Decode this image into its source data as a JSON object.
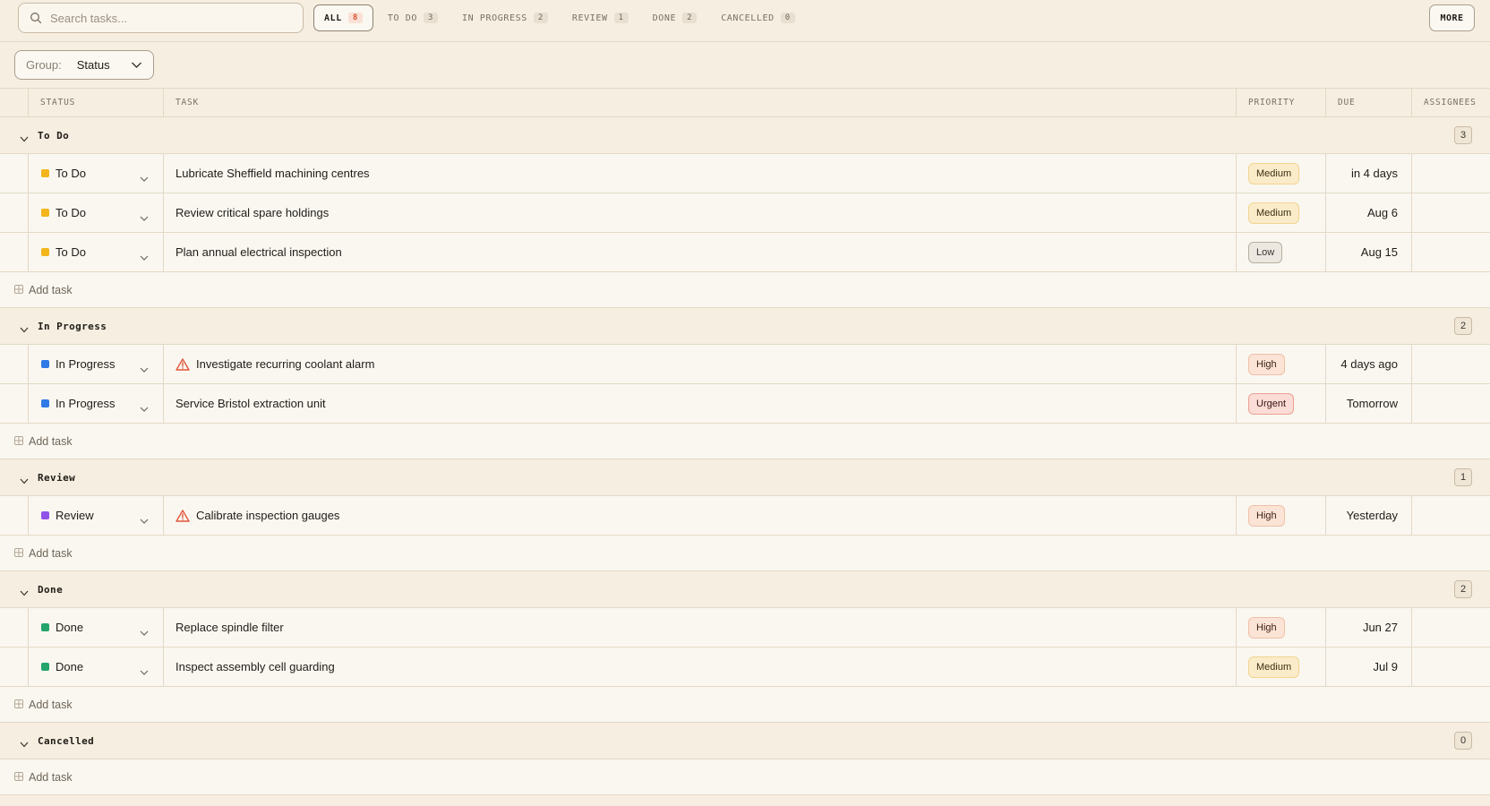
{
  "search": {
    "placeholder": "Search tasks..."
  },
  "tabs": [
    {
      "label": "ALL",
      "count": "8",
      "active": true
    },
    {
      "label": "TO DO",
      "count": "3"
    },
    {
      "label": "IN PROGRESS",
      "count": "2"
    },
    {
      "label": "REVIEW",
      "count": "1"
    },
    {
      "label": "DONE",
      "count": "2"
    },
    {
      "label": "CANCELLED",
      "count": "0"
    }
  ],
  "more_label": "MORE",
  "group": {
    "label": "Group:",
    "value": "Status"
  },
  "columns": {
    "status": "STATUS",
    "task": "TASK",
    "priority": "PRIORITY",
    "due": "DUE",
    "assignees": "ASSIGNEES"
  },
  "add_task_label": "Add task",
  "colors": {
    "todo": "#f2b61b",
    "in_progress": "#2f7ae5",
    "review": "#9152e8",
    "done": "#24a46b"
  },
  "groups": [
    {
      "title": "To Do",
      "count": "3",
      "rows": [
        {
          "status": "To Do",
          "task": "Lubricate Sheffield machining centres",
          "priority": "Medium",
          "due": "in 4 days"
        },
        {
          "status": "To Do",
          "task": "Review critical spare holdings",
          "priority": "Medium",
          "due": "Aug 6"
        },
        {
          "status": "To Do",
          "task": "Plan annual electrical inspection",
          "priority": "Low",
          "due": "Aug 15"
        }
      ]
    },
    {
      "title": "In Progress",
      "count": "2",
      "rows": [
        {
          "status": "In Progress",
          "task": "Investigate recurring coolant alarm",
          "priority": "High",
          "due": "4 days ago",
          "warning": true
        },
        {
          "status": "In Progress",
          "task": "Service Bristol extraction unit",
          "priority": "Urgent",
          "due": "Tomorrow"
        }
      ]
    },
    {
      "title": "Review",
      "count": "1",
      "rows": [
        {
          "status": "Review",
          "task": "Calibrate inspection gauges",
          "priority": "High",
          "due": "Yesterday",
          "warning": true
        }
      ]
    },
    {
      "title": "Done",
      "count": "2",
      "rows": [
        {
          "status": "Done",
          "task": "Replace spindle filter",
          "priority": "High",
          "due": "Jun 27"
        },
        {
          "status": "Done",
          "task": "Inspect assembly cell guarding",
          "priority": "Medium",
          "due": "Jul 9"
        }
      ]
    },
    {
      "title": "Cancelled",
      "count": "0",
      "rows": []
    }
  ]
}
